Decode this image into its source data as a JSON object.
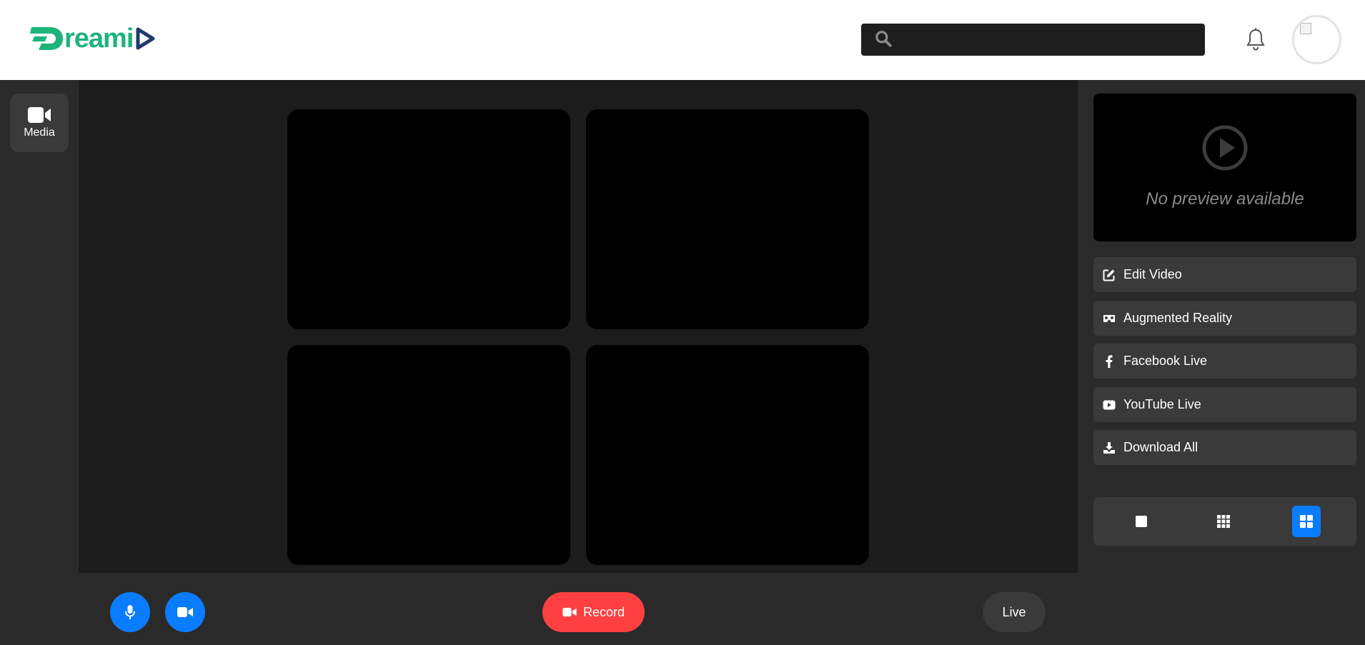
{
  "header": {
    "logo_text": "reami",
    "logo_initial": "D",
    "search": {
      "value": "",
      "placeholder": ""
    },
    "icons": {
      "search": "search-icon",
      "notifications": "bell-icon",
      "avatar": "user-avatar"
    }
  },
  "sidebar": {
    "items": [
      {
        "label": "Media",
        "icon": "video-camera-icon"
      }
    ]
  },
  "stage": {
    "tiles": [
      "participant-1",
      "participant-2",
      "participant-3",
      "participant-4"
    ]
  },
  "controls": {
    "mic_icon": "microphone-icon",
    "camera_icon": "video-camera-icon",
    "record_label": "Record",
    "live_label": "Live"
  },
  "right_panel": {
    "preview_text": "No preview available",
    "menu": [
      {
        "label": "Edit Video",
        "icon": "edit-icon"
      },
      {
        "label": "Augmented Reality",
        "icon": "vr-cardboard-icon"
      },
      {
        "label": "Facebook Live",
        "icon": "facebook-icon"
      },
      {
        "label": "YouTube Live",
        "icon": "youtube-icon"
      },
      {
        "label": "Download All",
        "icon": "download-icon"
      }
    ],
    "layouts": [
      {
        "name": "single",
        "active": false
      },
      {
        "name": "grid-3x3",
        "active": false
      },
      {
        "name": "grid-2x2",
        "active": true
      }
    ]
  },
  "colors": {
    "brand_green": "#1db47a",
    "brand_navy": "#1f3a6b",
    "accent_blue": "#0a7cff",
    "record_red": "#ff4040",
    "panel_bg": "#2a2a2a",
    "stage_bg": "#1c1c1c"
  }
}
